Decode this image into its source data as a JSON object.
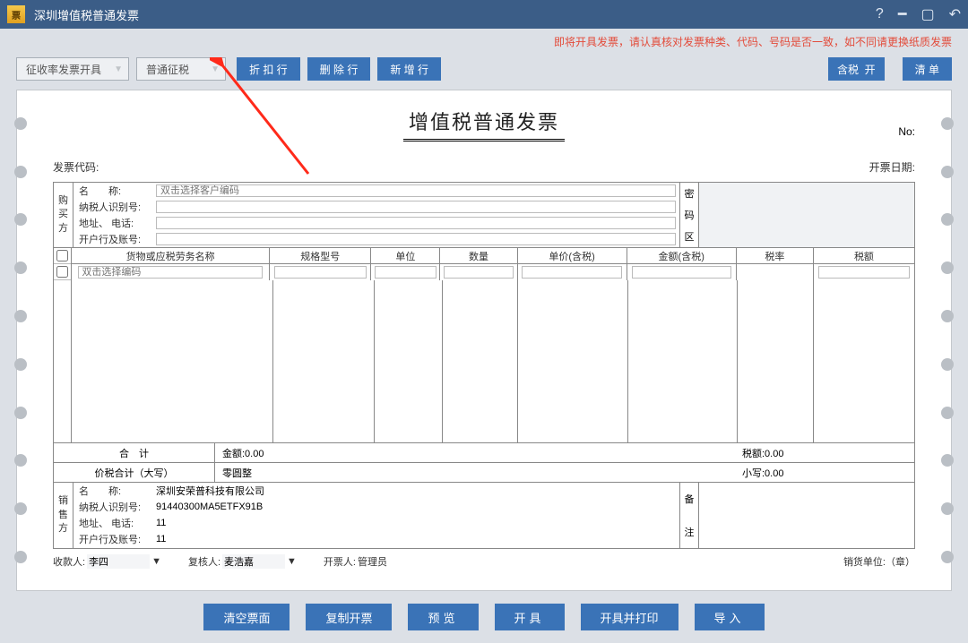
{
  "titlebar": {
    "title": "深圳增值税普通发票"
  },
  "warning": "即将开具发票，请认真核对发票种类、代码、号码是否一致，如不同请更换纸质发票",
  "toolbar": {
    "dd1": "征收率发票开具",
    "dd2": "普通征税",
    "discount": "折 扣 行",
    "delete": "删 除 行",
    "add": "新 增 行",
    "tax_incl": "含税",
    "toggle_on": "开",
    "list": "清  单"
  },
  "invoice": {
    "title": "增值税普通发票",
    "no_label": "No:",
    "code_label": "发票代码:",
    "date_label": "开票日期:",
    "buyer_vlabel": [
      "购",
      "买",
      "方"
    ],
    "buyer": {
      "name_label": "名　　称:",
      "name_placeholder": "双击选择客户编码",
      "taxid_label": "纳税人识别号:",
      "addr_label": "地址、 电话:",
      "bank_label": "开户行及账号:"
    },
    "pass_vlabel": [
      "密",
      "码",
      "区"
    ],
    "columns": [
      "货物或应税劳务名称",
      "规格型号",
      "单位",
      "数量",
      "单价(含税)",
      "金额(含税)",
      "税率",
      "税额"
    ],
    "row1_placeholder": "双击选择编码",
    "totals_label": "合　计",
    "amount_label": "金额:0.00",
    "taxamt_label": "税额:0.00",
    "pricetax_label": "价税合计（大写）",
    "pricetax_cn": "零圆整",
    "small_label": "小写:0.00",
    "seller_vlabel": [
      "销",
      "售",
      "方"
    ],
    "seller": {
      "name_label": "名　　称:",
      "name_val": "深圳安荣普科技有限公司",
      "taxid_label": "纳税人识别号:",
      "taxid_val": "91440300MA5ETFX91B",
      "addr_label": "地址、 电话:",
      "addr_val": "11",
      "bank_label": "开户行及账号:",
      "bank_val": "11"
    },
    "remark_vlabel": [
      "备",
      "注"
    ],
    "footer": {
      "payee_label": "收款人:",
      "payee_val": "李四",
      "reviewer_label": "复核人:",
      "reviewer_val": "麦浩嘉",
      "drawer_label": "开票人:",
      "drawer_val": "管理员",
      "unit_label": "销货单位:（章）"
    }
  },
  "bottom": {
    "clear": "清空票面",
    "copy": "复制开票",
    "preview": "预览",
    "issue": "开具",
    "issue_print": "开具并打印",
    "import": "导入"
  }
}
